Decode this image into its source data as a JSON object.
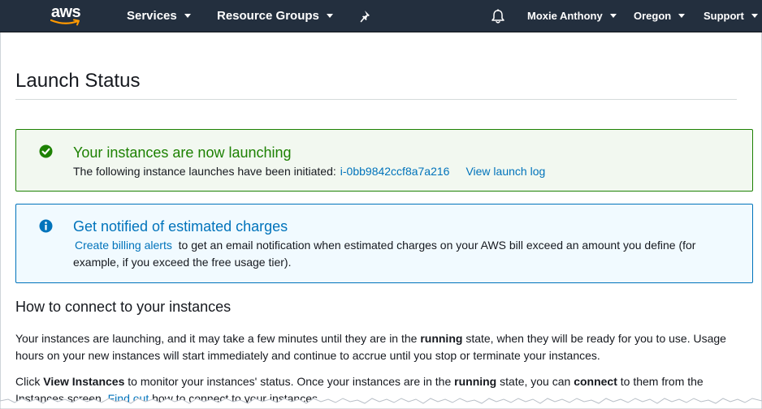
{
  "nav": {
    "logo_text": "aws",
    "services": "Services",
    "resource_groups": "Resource Groups",
    "user": "Moxie Anthony",
    "region": "Oregon",
    "support": "Support"
  },
  "page": {
    "title": "Launch Status"
  },
  "success_alert": {
    "title": "Your instances are now launching",
    "body_text": "The following instance launches have been initiated:",
    "instance_id": "i-0bb9842ccf8a7a216",
    "view_log": "View launch log"
  },
  "info_alert": {
    "title": "Get notified of estimated charges",
    "link": "Create billing alerts",
    "body_text": "to get an email notification when estimated charges on your AWS bill exceed an amount you define (for example, if you exceed the free usage tier)."
  },
  "connect": {
    "heading": "How to connect to your instances",
    "p1": {
      "a": "Your instances are launching, and it may take a few minutes until they are in the",
      "b": "running",
      "c": "state, when they will be ready for you to use. Usage hours on your new instances will start immediately and continue to accrue until you stop or terminate your instances."
    },
    "p2": {
      "a": "Click",
      "b": "View Instances",
      "c": "to monitor your instances' status. Once your instances are in the",
      "d": "running",
      "e": "state, you can",
      "f": "connect",
      "g": "to them from the Instances screen.",
      "h": "Find out",
      "i": "how to connect to your instances."
    }
  },
  "colors": {
    "nav_bg": "#232f3e",
    "success": "#1d8102",
    "info": "#0073bb",
    "aws_orange": "#ff9900"
  },
  "icons": [
    "pin-icon",
    "bell-icon",
    "check-circle-icon",
    "info-circle-icon"
  ]
}
